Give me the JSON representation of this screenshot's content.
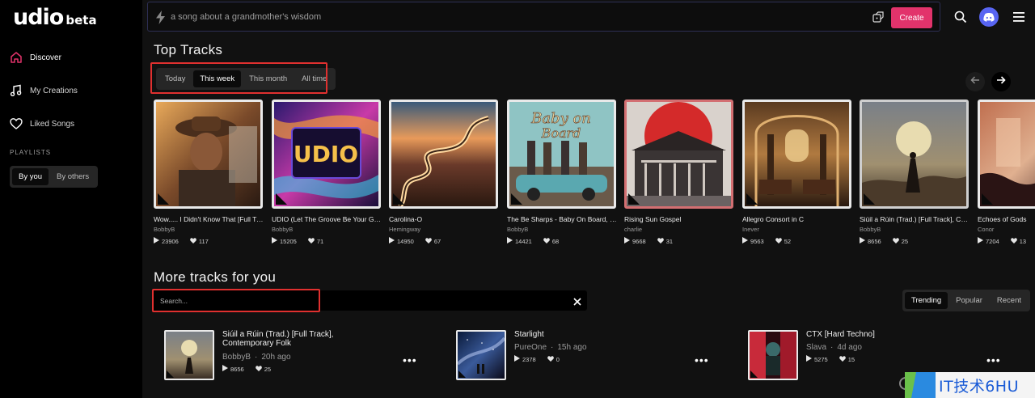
{
  "app": {
    "logo": "udio",
    "logo_badge": "beta"
  },
  "sidebar": {
    "nav": [
      {
        "label": "Discover",
        "icon": "home-icon",
        "active": true
      },
      {
        "label": "My Creations",
        "icon": "music-note-icon",
        "active": false
      },
      {
        "label": "Liked Songs",
        "icon": "heart-icon",
        "active": false
      }
    ],
    "playlists_label": "PLAYLISTS",
    "playlist_filters": [
      "By you",
      "By others"
    ],
    "playlist_filter_selected": "By you"
  },
  "topbar": {
    "prompt_placeholder": "a song about a grandmother's wisdom",
    "create_label": "Create"
  },
  "top_tracks": {
    "title": "Top Tracks",
    "periods": [
      "Today",
      "This week",
      "This month",
      "All time"
    ],
    "period_selected": "This week",
    "cards": [
      {
        "title": "Wow..... I Didn't Know That [Full Track]",
        "artist": "BobbyB",
        "plays": "23906",
        "likes": "117"
      },
      {
        "title": "UDIO (Let The Groove Be Your Guide)",
        "artist": "BobbyB",
        "plays": "15205",
        "likes": "71"
      },
      {
        "title": "Carolina-O",
        "artist": "Hemingway",
        "plays": "14950",
        "likes": "67"
      },
      {
        "title": "The Be Sharps - Baby On Board, Extended",
        "artist": "BobbyB",
        "plays": "14421",
        "likes": "68"
      },
      {
        "title": "Rising Sun Gospel",
        "artist": "charlie",
        "plays": "9668",
        "likes": "31"
      },
      {
        "title": "Allegro Consort in C",
        "artist": "Inever",
        "plays": "9563",
        "likes": "52"
      },
      {
        "title": "Siúil a Rúin (Trad.) [Full Track], Contemporary Folk",
        "artist": "BobbyB",
        "plays": "8656",
        "likes": "25"
      },
      {
        "title": "Echoes of Gods",
        "artist": "Conor",
        "plays": "7204",
        "likes": "13"
      }
    ]
  },
  "more_tracks": {
    "title": "More tracks for you",
    "search_placeholder": "Search...",
    "sort_options": [
      "Trending",
      "Popular",
      "Recent"
    ],
    "sort_selected": "Trending",
    "items": [
      {
        "title_line1": "Siúil a Rúin (Trad.) [Full Track],",
        "title_line2": "Contemporary Folk",
        "artist": "BobbyB",
        "age": "20h ago",
        "plays": "8656",
        "likes": "25"
      },
      {
        "title_line1": "Starlight",
        "title_line2": "",
        "artist": "PureOne",
        "age": "15h ago",
        "plays": "2378",
        "likes": "0"
      },
      {
        "title_line1": "CTX [Hard Techno]",
        "title_line2": "",
        "artist": "Slava",
        "age": "4d ago",
        "plays": "5275",
        "likes": "15"
      }
    ]
  },
  "watermark": {
    "text": "IT技术6HU"
  },
  "colors": {
    "accent": "#e2336b",
    "highlight_box": "#e0302f",
    "discord": "#5865f2",
    "background": "#111111"
  }
}
